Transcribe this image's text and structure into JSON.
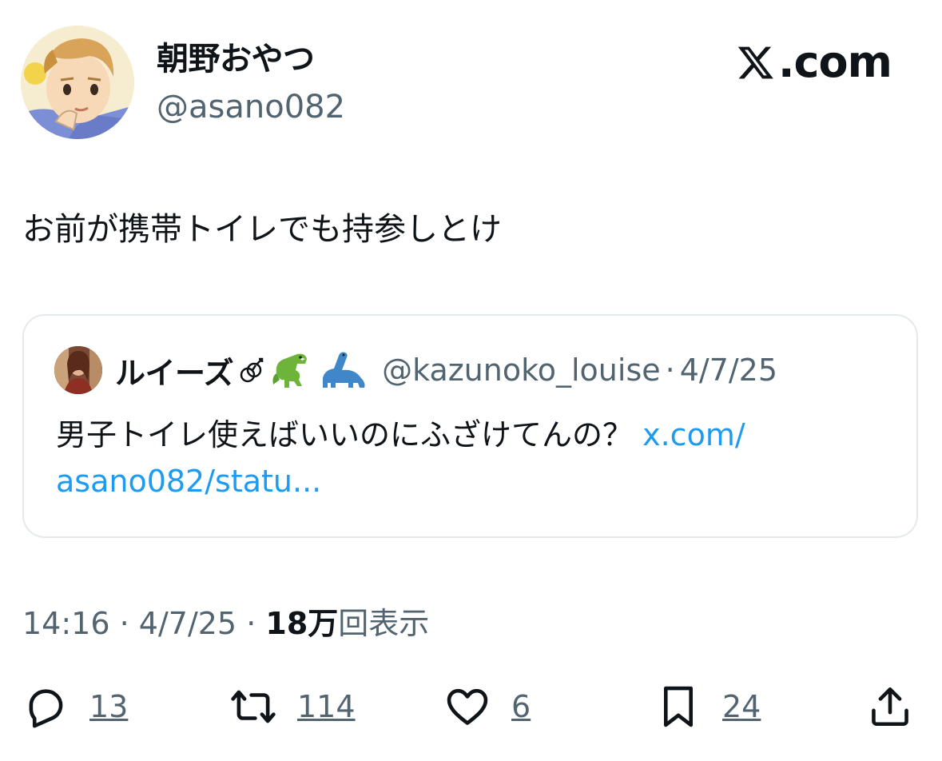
{
  "author": {
    "display_name": "朝野おやつ",
    "handle": "@asano082"
  },
  "brand": {
    "label": ".com",
    "icon": "x-logo-icon"
  },
  "tweet": {
    "text": "お前が携帯トイレでも持参しとけ"
  },
  "quote": {
    "display_name": "ルイーズ",
    "badges": [
      "double-male-symbol-icon",
      "t-rex-emoji-icon",
      "sauropod-emoji-icon"
    ],
    "handle": "@kazunoko_louise",
    "separator": "·",
    "date": "4/7/25",
    "text": "男子トイレ使えばいいのにふざけてんの？",
    "link_line1": "x.com/",
    "link_line2": "asano082/statu..."
  },
  "meta": {
    "time": "14:16",
    "sep1": "·",
    "date": "4/7/25",
    "sep2": "·",
    "views_count": "18万",
    "views_label": "回表示"
  },
  "actions": {
    "replies": "13",
    "reposts": "114",
    "likes": "6",
    "bookmarks": "24"
  },
  "colors": {
    "text": "#0f1419",
    "secondary": "#536471",
    "link": "#1d9bf0",
    "border": "#e4e9ed"
  }
}
